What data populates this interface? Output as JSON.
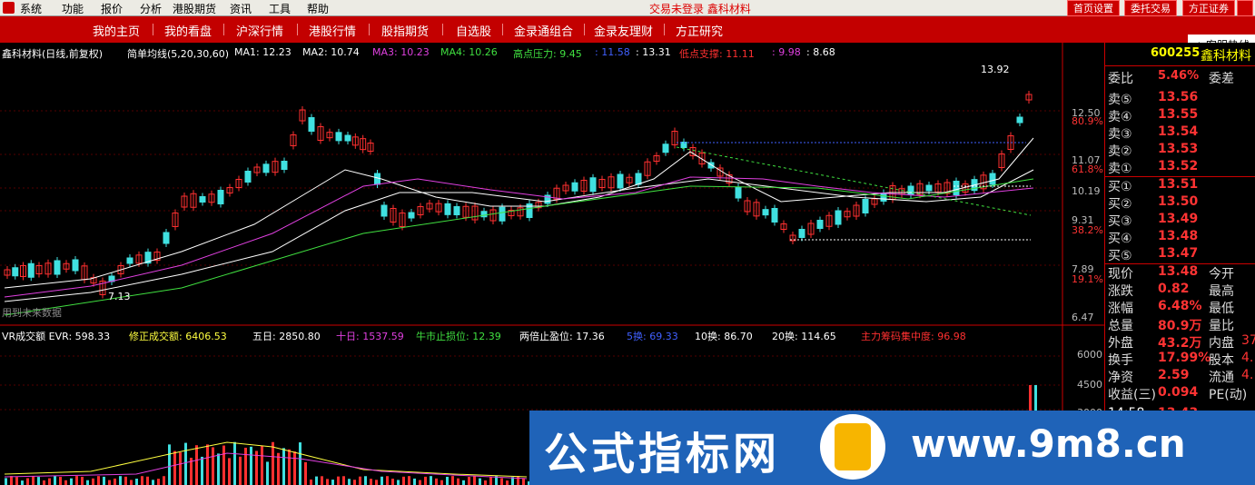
{
  "menu": {
    "items": [
      "系统",
      "功能",
      "报价",
      "分析",
      "港股期货",
      "资讯",
      "工具",
      "帮助"
    ],
    "status": "交易未登录  鑫科材料",
    "buttons": [
      "首页设置",
      "委托交易",
      "方正证券"
    ]
  },
  "nav": {
    "items": [
      "我的主页",
      "我的看盘",
      "沪深行情",
      "港股行情",
      "股指期货",
      "自选股",
      "金录通组合",
      "金录友理财",
      "方正研究"
    ],
    "hotline": "客服热线"
  },
  "main_chart": {
    "title": "鑫科材料(日线,前复权)",
    "indicator": "简单均线(5,20,30,60)",
    "ma": [
      {
        "label": "MA1: 12.23",
        "color": "#ffffff"
      },
      {
        "label": "MA2: 10.74",
        "color": "#ffffff"
      },
      {
        "label": "MA3: 10.23",
        "color": "#e040e0"
      },
      {
        "label": "MA4: 10.26",
        "color": "#40e040"
      },
      {
        "label": "高点压力: 9.45",
        "color": "#40e040"
      },
      {
        "label": ": 11.58",
        "color": "#4060ff"
      },
      {
        "label": ": 13.31",
        "color": "#ffffff"
      },
      {
        "label": "低点支撑: 11.11",
        "color": "#ff3030"
      },
      {
        "label": ": 9.98",
        "color": "#e040e0"
      },
      {
        "label": ": 8.68",
        "color": "#ffffff"
      }
    ],
    "y_ticks": [
      "12.50",
      "80.9%",
      "11.07",
      "61.8%",
      "10.19",
      "9.31",
      "38.2%",
      "7.89",
      "19.1%",
      "6.47"
    ],
    "high_label": "13.92",
    "low_label": "7.13",
    "footnote": "用到未来数据"
  },
  "volume_chart": {
    "items": [
      {
        "label": "VR成交额  EVR: 598.33",
        "color": "#ffffff"
      },
      {
        "label": "修正成交额: 6406.53",
        "color": "#ffff40"
      },
      {
        "label": "五日: 2850.80",
        "color": "#ffffff"
      },
      {
        "label": "十日: 1537.59",
        "color": "#e040e0"
      },
      {
        "label": "牛市止损位: 12.39",
        "color": "#40e040"
      },
      {
        "label": "两倍止盈位: 17.36",
        "color": "#ffffff"
      },
      {
        "label": "5换: 69.33",
        "color": "#4060ff"
      },
      {
        "label": "10换: 86.70",
        "color": "#ffffff"
      },
      {
        "label": "20换: 114.65",
        "color": "#ffffff"
      },
      {
        "label": "主力筹码集中度: 96.98",
        "color": "#ff3030"
      }
    ],
    "y_ticks": [
      "6000",
      "4500",
      "3000"
    ]
  },
  "quote": {
    "code": "600255",
    "name": "鑫科材料",
    "webi": {
      "label": "委比",
      "value": "5.46%",
      "label2": "委差"
    },
    "sell": [
      {
        "label": "卖⑤",
        "price": "13.56"
      },
      {
        "label": "卖④",
        "price": "13.55"
      },
      {
        "label": "卖③",
        "price": "13.54"
      },
      {
        "label": "卖②",
        "price": "13.53"
      },
      {
        "label": "卖①",
        "price": "13.52"
      }
    ],
    "buy": [
      {
        "label": "买①",
        "price": "13.51"
      },
      {
        "label": "买②",
        "price": "13.50"
      },
      {
        "label": "买③",
        "price": "13.49"
      },
      {
        "label": "买④",
        "price": "13.48"
      },
      {
        "label": "买⑤",
        "price": "13.47"
      }
    ],
    "stats": [
      {
        "label": "现价",
        "value": "13.48",
        "label2": "今开",
        "value2": ""
      },
      {
        "label": "涨跌",
        "value": "0.82",
        "label2": "最高",
        "value2": ""
      },
      {
        "label": "涨幅",
        "value": "6.48%",
        "label2": "最低",
        "value2": ""
      },
      {
        "label": "总量",
        "value": "80.9万",
        "label2": "量比",
        "value2": ""
      },
      {
        "label": "外盘",
        "value": "43.2万",
        "label2": "内盘",
        "value2": "37"
      },
      {
        "label": "换手",
        "value": "17.99%",
        "label2": "股本",
        "value2": "4."
      },
      {
        "label": "净资",
        "value": "2.59",
        "label2": "流通",
        "value2": "4."
      },
      {
        "label": "收益(三)",
        "value": "0.094",
        "label2": "PE(动)",
        "value2": ""
      }
    ],
    "bottom_time": "14:58",
    "bottom_price": "13.43"
  },
  "watermark": {
    "text": "公式指标网",
    "url": "www.9m8.cn"
  },
  "colors": {
    "up": "#ff3030",
    "down": "#40e0e0",
    "menu_bg": "#ecebe4",
    "nav_bg": "#c30000",
    "watermark_bg": "#1f63b8"
  }
}
